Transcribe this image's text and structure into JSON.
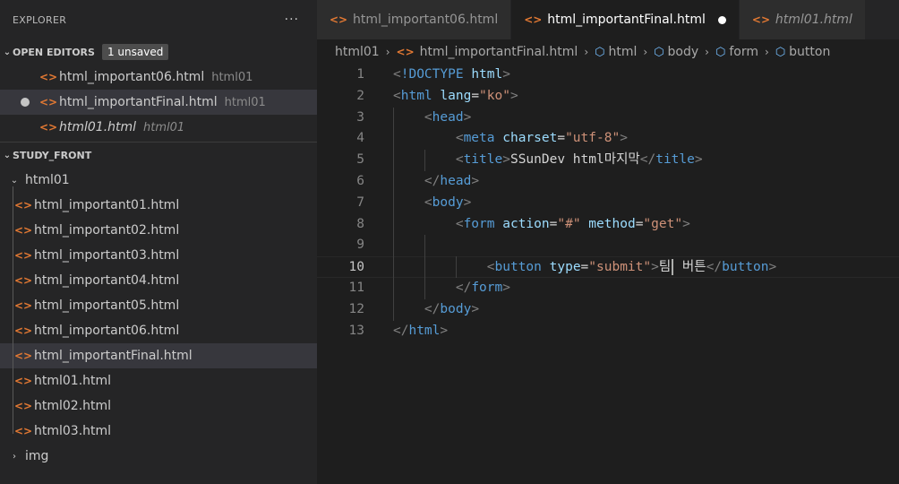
{
  "explorer": {
    "title": "EXPLORER",
    "more": "···"
  },
  "open_editors": {
    "label": "OPEN EDITORS",
    "badge": "1 unsaved",
    "items": [
      {
        "name": "html_important06.html",
        "folder": "html01",
        "dirty": false,
        "italic": false
      },
      {
        "name": "html_importantFinal.html",
        "folder": "html01",
        "dirty": true,
        "italic": false
      },
      {
        "name": "html01.html",
        "folder": "html01",
        "dirty": false,
        "italic": true
      }
    ]
  },
  "workspace": {
    "label": "STUDY_FRONT",
    "folder": "html01",
    "files": [
      "html_important01.html",
      "html_important02.html",
      "html_important03.html",
      "html_important04.html",
      "html_important05.html",
      "html_important06.html",
      "html_importantFinal.html",
      "html01.html",
      "html02.html",
      "html03.html"
    ],
    "collapsed_folder": "img"
  },
  "tabs": [
    {
      "label": "html_important06.html",
      "active": false,
      "dirty": false,
      "italic": false
    },
    {
      "label": "html_importantFinal.html",
      "active": true,
      "dirty": true,
      "italic": false
    },
    {
      "label": "html01.html",
      "active": false,
      "dirty": false,
      "italic": true
    }
  ],
  "breadcrumbs": [
    "html01",
    "html_importantFinal.html",
    "html",
    "body",
    "form",
    "button"
  ],
  "editor": {
    "active_line": 10,
    "lines": [
      {
        "n": "1",
        "tokens": [
          [
            "punct",
            "<"
          ],
          [
            "tag",
            "!DOCTYPE"
          ],
          [
            "txt",
            " "
          ],
          [
            "attr",
            "html"
          ],
          [
            "punct",
            ">"
          ]
        ]
      },
      {
        "n": "2",
        "tokens": [
          [
            "punct",
            "<"
          ],
          [
            "tag",
            "html"
          ],
          [
            "txt",
            " "
          ],
          [
            "attr",
            "lang"
          ],
          [
            "txt",
            "="
          ],
          [
            "str",
            "\"ko\""
          ],
          [
            "punct",
            ">"
          ]
        ]
      },
      {
        "n": "3",
        "tokens": [
          [
            "txt",
            "    "
          ],
          [
            "punct",
            "<"
          ],
          [
            "tag",
            "head"
          ],
          [
            "punct",
            ">"
          ]
        ]
      },
      {
        "n": "4",
        "tokens": [
          [
            "txt",
            "        "
          ],
          [
            "punct",
            "<"
          ],
          [
            "tag",
            "meta"
          ],
          [
            "txt",
            " "
          ],
          [
            "attr",
            "charset"
          ],
          [
            "txt",
            "="
          ],
          [
            "str",
            "\"utf-8\""
          ],
          [
            "punct",
            ">"
          ]
        ]
      },
      {
        "n": "5",
        "tokens": [
          [
            "txt",
            "        "
          ],
          [
            "punct",
            "<"
          ],
          [
            "tag",
            "title"
          ],
          [
            "punct",
            ">"
          ],
          [
            "txt",
            "SSunDev html마지막"
          ],
          [
            "punct",
            "</"
          ],
          [
            "tag",
            "title"
          ],
          [
            "punct",
            ">"
          ]
        ]
      },
      {
        "n": "6",
        "tokens": [
          [
            "txt",
            "    "
          ],
          [
            "punct",
            "</"
          ],
          [
            "tag",
            "head"
          ],
          [
            "punct",
            ">"
          ]
        ]
      },
      {
        "n": "7",
        "tokens": [
          [
            "txt",
            "    "
          ],
          [
            "punct",
            "<"
          ],
          [
            "tag",
            "body"
          ],
          [
            "punct",
            ">"
          ]
        ]
      },
      {
        "n": "8",
        "tokens": [
          [
            "txt",
            "        "
          ],
          [
            "punct",
            "<"
          ],
          [
            "tag",
            "form"
          ],
          [
            "txt",
            " "
          ],
          [
            "attr",
            "action"
          ],
          [
            "txt",
            "="
          ],
          [
            "str",
            "\"#\""
          ],
          [
            "txt",
            " "
          ],
          [
            "attr",
            "method"
          ],
          [
            "txt",
            "="
          ],
          [
            "str",
            "\"get\""
          ],
          [
            "punct",
            ">"
          ]
        ]
      },
      {
        "n": "9",
        "tokens": []
      },
      {
        "n": "10",
        "tokens": [
          [
            "txt",
            "            "
          ],
          [
            "punct",
            "<"
          ],
          [
            "tag",
            "button"
          ],
          [
            "txt",
            " "
          ],
          [
            "attr",
            "type"
          ],
          [
            "txt",
            "="
          ],
          [
            "str",
            "\"submit\""
          ],
          [
            "punct",
            ">"
          ],
          [
            "txt",
            "팀"
          ],
          [
            "caret",
            ""
          ],
          [
            "txt",
            " 버튼"
          ],
          [
            "punct",
            "</"
          ],
          [
            "tag",
            "button"
          ],
          [
            "punct",
            ">"
          ]
        ]
      },
      {
        "n": "11",
        "tokens": [
          [
            "txt",
            "        "
          ],
          [
            "punct",
            "</"
          ],
          [
            "tag",
            "form"
          ],
          [
            "punct",
            ">"
          ]
        ]
      },
      {
        "n": "12",
        "tokens": [
          [
            "txt",
            "    "
          ],
          [
            "punct",
            "</"
          ],
          [
            "tag",
            "body"
          ],
          [
            "punct",
            ">"
          ]
        ]
      },
      {
        "n": "13",
        "tokens": [
          [
            "punct",
            "</"
          ],
          [
            "tag",
            "html"
          ],
          [
            "punct",
            ">"
          ]
        ]
      }
    ]
  },
  "colors": {
    "file_icon": "#e37933",
    "tag": "#569cd6",
    "attr": "#9cdcfe",
    "string": "#ce9178",
    "punct": "#808080"
  }
}
